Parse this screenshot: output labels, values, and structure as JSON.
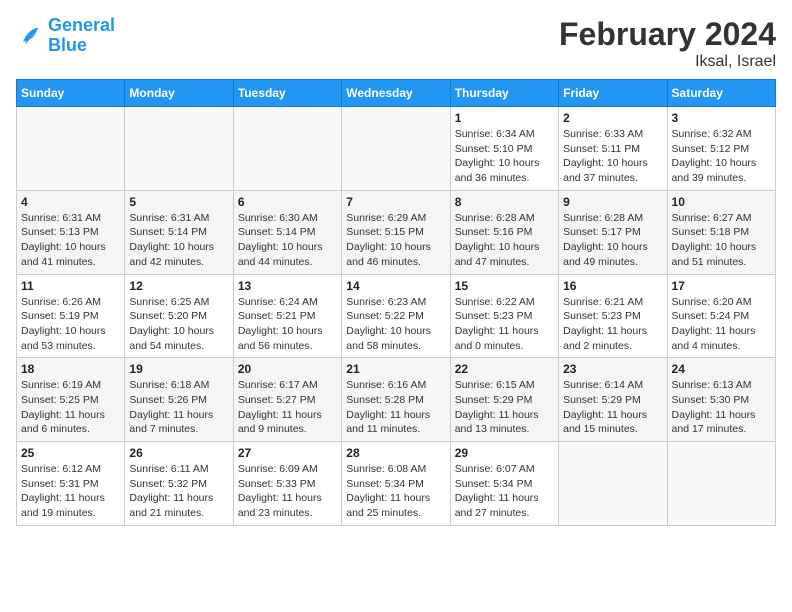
{
  "header": {
    "logo_line1": "General",
    "logo_line2": "Blue",
    "title": "February 2024",
    "subtitle": "Iksal, Israel"
  },
  "days_of_week": [
    "Sunday",
    "Monday",
    "Tuesday",
    "Wednesday",
    "Thursday",
    "Friday",
    "Saturday"
  ],
  "weeks": [
    [
      {
        "day": "",
        "info": ""
      },
      {
        "day": "",
        "info": ""
      },
      {
        "day": "",
        "info": ""
      },
      {
        "day": "",
        "info": ""
      },
      {
        "day": "1",
        "info": "Sunrise: 6:34 AM\nSunset: 5:10 PM\nDaylight: 10 hours\nand 36 minutes."
      },
      {
        "day": "2",
        "info": "Sunrise: 6:33 AM\nSunset: 5:11 PM\nDaylight: 10 hours\nand 37 minutes."
      },
      {
        "day": "3",
        "info": "Sunrise: 6:32 AM\nSunset: 5:12 PM\nDaylight: 10 hours\nand 39 minutes."
      }
    ],
    [
      {
        "day": "4",
        "info": "Sunrise: 6:31 AM\nSunset: 5:13 PM\nDaylight: 10 hours\nand 41 minutes."
      },
      {
        "day": "5",
        "info": "Sunrise: 6:31 AM\nSunset: 5:14 PM\nDaylight: 10 hours\nand 42 minutes."
      },
      {
        "day": "6",
        "info": "Sunrise: 6:30 AM\nSunset: 5:14 PM\nDaylight: 10 hours\nand 44 minutes."
      },
      {
        "day": "7",
        "info": "Sunrise: 6:29 AM\nSunset: 5:15 PM\nDaylight: 10 hours\nand 46 minutes."
      },
      {
        "day": "8",
        "info": "Sunrise: 6:28 AM\nSunset: 5:16 PM\nDaylight: 10 hours\nand 47 minutes."
      },
      {
        "day": "9",
        "info": "Sunrise: 6:28 AM\nSunset: 5:17 PM\nDaylight: 10 hours\nand 49 minutes."
      },
      {
        "day": "10",
        "info": "Sunrise: 6:27 AM\nSunset: 5:18 PM\nDaylight: 10 hours\nand 51 minutes."
      }
    ],
    [
      {
        "day": "11",
        "info": "Sunrise: 6:26 AM\nSunset: 5:19 PM\nDaylight: 10 hours\nand 53 minutes."
      },
      {
        "day": "12",
        "info": "Sunrise: 6:25 AM\nSunset: 5:20 PM\nDaylight: 10 hours\nand 54 minutes."
      },
      {
        "day": "13",
        "info": "Sunrise: 6:24 AM\nSunset: 5:21 PM\nDaylight: 10 hours\nand 56 minutes."
      },
      {
        "day": "14",
        "info": "Sunrise: 6:23 AM\nSunset: 5:22 PM\nDaylight: 10 hours\nand 58 minutes."
      },
      {
        "day": "15",
        "info": "Sunrise: 6:22 AM\nSunset: 5:23 PM\nDaylight: 11 hours\nand 0 minutes."
      },
      {
        "day": "16",
        "info": "Sunrise: 6:21 AM\nSunset: 5:23 PM\nDaylight: 11 hours\nand 2 minutes."
      },
      {
        "day": "17",
        "info": "Sunrise: 6:20 AM\nSunset: 5:24 PM\nDaylight: 11 hours\nand 4 minutes."
      }
    ],
    [
      {
        "day": "18",
        "info": "Sunrise: 6:19 AM\nSunset: 5:25 PM\nDaylight: 11 hours\nand 6 minutes."
      },
      {
        "day": "19",
        "info": "Sunrise: 6:18 AM\nSunset: 5:26 PM\nDaylight: 11 hours\nand 7 minutes."
      },
      {
        "day": "20",
        "info": "Sunrise: 6:17 AM\nSunset: 5:27 PM\nDaylight: 11 hours\nand 9 minutes."
      },
      {
        "day": "21",
        "info": "Sunrise: 6:16 AM\nSunset: 5:28 PM\nDaylight: 11 hours\nand 11 minutes."
      },
      {
        "day": "22",
        "info": "Sunrise: 6:15 AM\nSunset: 5:29 PM\nDaylight: 11 hours\nand 13 minutes."
      },
      {
        "day": "23",
        "info": "Sunrise: 6:14 AM\nSunset: 5:29 PM\nDaylight: 11 hours\nand 15 minutes."
      },
      {
        "day": "24",
        "info": "Sunrise: 6:13 AM\nSunset: 5:30 PM\nDaylight: 11 hours\nand 17 minutes."
      }
    ],
    [
      {
        "day": "25",
        "info": "Sunrise: 6:12 AM\nSunset: 5:31 PM\nDaylight: 11 hours\nand 19 minutes."
      },
      {
        "day": "26",
        "info": "Sunrise: 6:11 AM\nSunset: 5:32 PM\nDaylight: 11 hours\nand 21 minutes."
      },
      {
        "day": "27",
        "info": "Sunrise: 6:09 AM\nSunset: 5:33 PM\nDaylight: 11 hours\nand 23 minutes."
      },
      {
        "day": "28",
        "info": "Sunrise: 6:08 AM\nSunset: 5:34 PM\nDaylight: 11 hours\nand 25 minutes."
      },
      {
        "day": "29",
        "info": "Sunrise: 6:07 AM\nSunset: 5:34 PM\nDaylight: 11 hours\nand 27 minutes."
      },
      {
        "day": "",
        "info": ""
      },
      {
        "day": "",
        "info": ""
      }
    ]
  ]
}
